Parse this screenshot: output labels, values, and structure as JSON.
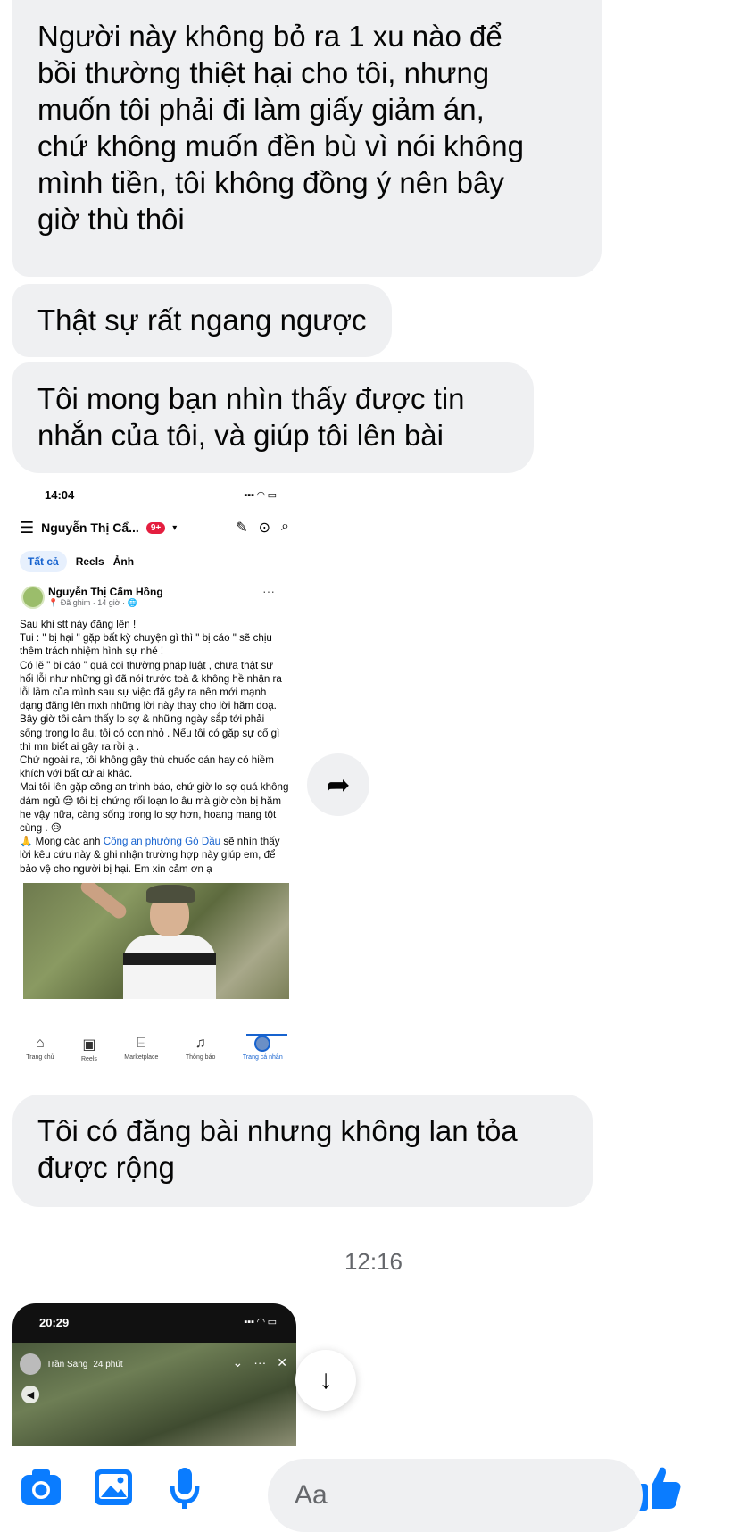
{
  "messages": [
    "Người này không bỏ ra 1 xu nào để\nbồi thường thiệt hại cho tôi, nhưng\nmuốn tôi phải đi làm giấy giảm án,\nchứ không muốn đền bù vì nói không\nmình tiền, tôi không đồng ý nên bây\ngiờ thù thôi",
    "Thật sự rất ngang ngược",
    "Tôi mong bạn nhìn thấy được tin\nnhắn của tôi, và giúp tôi lên bài",
    "Tôi có đăng bài nhưng không lan tỏa\nđược rộng"
  ],
  "timestamp": "12:16",
  "shot1": {
    "time": "14:04",
    "profile_name": "Nguyễn Thị Cẩ...",
    "badge": "9+",
    "tabs": [
      "Tất cả",
      "Reels",
      "Ảnh"
    ],
    "author": "Nguyễn Thị Cẩm Hồng",
    "meta": "📍 Đã ghim · 14 giờ · 🌐",
    "post_lines": [
      "Sau khi stt này đăng lên !",
      "Tui : \" bị hại \" gặp bất kỳ chuyện gì thì \" bị cáo \" sẽ chịu thêm trách nhiệm hình sự nhé !",
      "Có lẽ \" bị cáo \" quá coi thường pháp luật , chưa thật sự hối lỗi như những gì đã nói trước toà & không hề nhận ra lỗi lầm của mình sau sự việc đã gây ra nên mới mạnh dạng đăng lên mxh những lời này thay cho lời hăm doạ.",
      "Bây giờ tôi cảm thấy lo sợ & những ngày sắp tới phải sống trong lo âu, tôi có con nhỏ . Nếu tôi có gặp sự cố gì thì mn biết ai gây ra rồi ạ .",
      "Chứ ngoài ra, tôi không gây thù chuốc oán hay có hiềm khích với bất cứ ai khác.",
      "Mai tôi lên gặp công an trình báo, chứ giờ lo sợ quá không dám ngủ 😔 tôi bị chứng rối loạn lo âu mà giờ còn bị hăm he vậy nữa, càng sống trong lo sợ hơn, hoang mang tột cùng . 😥"
    ],
    "post_last_prefix": "🙏 Mong các anh ",
    "post_link": "Công an phường Gò Dầu",
    "post_last_suffix": " sẽ nhìn thấy lời kêu cứu này & ghi nhận trường hợp này giúp em, để bảo vệ cho người bị hại. Em xin cảm ơn ạ",
    "nav": [
      "Trang chủ",
      "Reels",
      "Marketplace",
      "Thông báo",
      "Trang cá nhân"
    ]
  },
  "shot2": {
    "time": "20:29",
    "author": "Trần Sang",
    "ago": "24 phút"
  },
  "composer": {
    "placeholder": "Aa"
  },
  "colors": {
    "bubble": "#eff0f2",
    "accent": "#0a7cff"
  }
}
